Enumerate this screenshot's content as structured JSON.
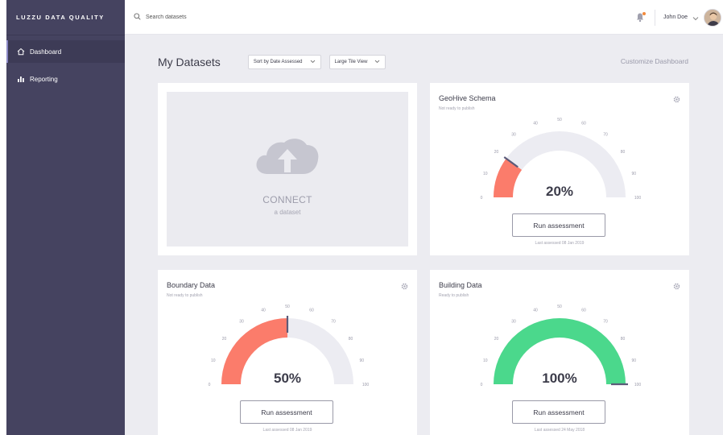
{
  "app": {
    "brand": "LUZZU DATA QUALITY"
  },
  "sidebar": {
    "items": [
      {
        "label": "Dashboard",
        "icon": "home-icon",
        "active": true
      },
      {
        "label": "Reporting",
        "icon": "bar-chart-icon",
        "active": false
      }
    ]
  },
  "topbar": {
    "search_placeholder": "Search datasets",
    "user_name": "John Doe",
    "notification_dot_color": "#f28a3c"
  },
  "main": {
    "title": "My Datasets",
    "sort_select": "Sort by Date Assessed",
    "view_select": "Large Tile View",
    "customize": "Customize Dashboard"
  },
  "connect": {
    "label": "CONNECT",
    "sublabel": "a dataset"
  },
  "gauge_ticks": [
    "0",
    "10",
    "20",
    "30",
    "40",
    "50",
    "60",
    "70",
    "80",
    "90",
    "100"
  ],
  "datasets": [
    {
      "title": "GeoHive Schema",
      "status": "Not ready to publish",
      "value": 20,
      "value_label": "20%",
      "color": "#fb7c6b",
      "button": "Run assessment",
      "last": "Last assessed 08 Jan 2019"
    },
    {
      "title": "Boundary Data",
      "status": "Not ready to publish",
      "value": 50,
      "value_label": "50%",
      "color": "#fb7c6b",
      "button": "Run assessment",
      "last": "Last assessed 08 Jan 2019"
    },
    {
      "title": "Building Data",
      "status": "Ready to publish",
      "value": 100,
      "value_label": "100%",
      "color": "#4bd88c",
      "button": "Run assessment",
      "last": "Last assessed 24 May 2018"
    }
  ],
  "colors": {
    "sidebar": "#454360",
    "background": "#ececf1",
    "track": "#ececf2",
    "needle": "#5c5b79"
  }
}
